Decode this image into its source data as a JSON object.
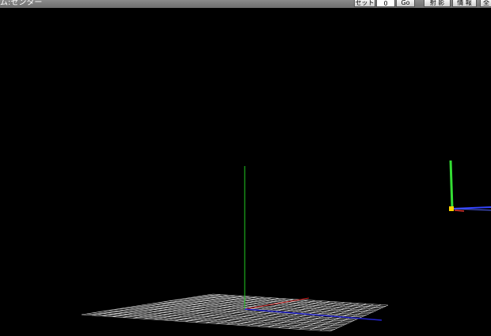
{
  "window": {
    "title": "ム:センター"
  },
  "toolbar": {
    "set_label": "セット",
    "frame_value": "0",
    "go_label": "Go",
    "projection_label": "射 影",
    "info_label": "情 報",
    "cut_label": "全"
  },
  "viewport": {
    "background": "#000000",
    "grid_color": "#ffffff",
    "axis_colors": {
      "x": "#cc2222",
      "y": "#22cc22",
      "z": "#2222cc"
    },
    "gizmo_handle_color": "#ffd400"
  }
}
